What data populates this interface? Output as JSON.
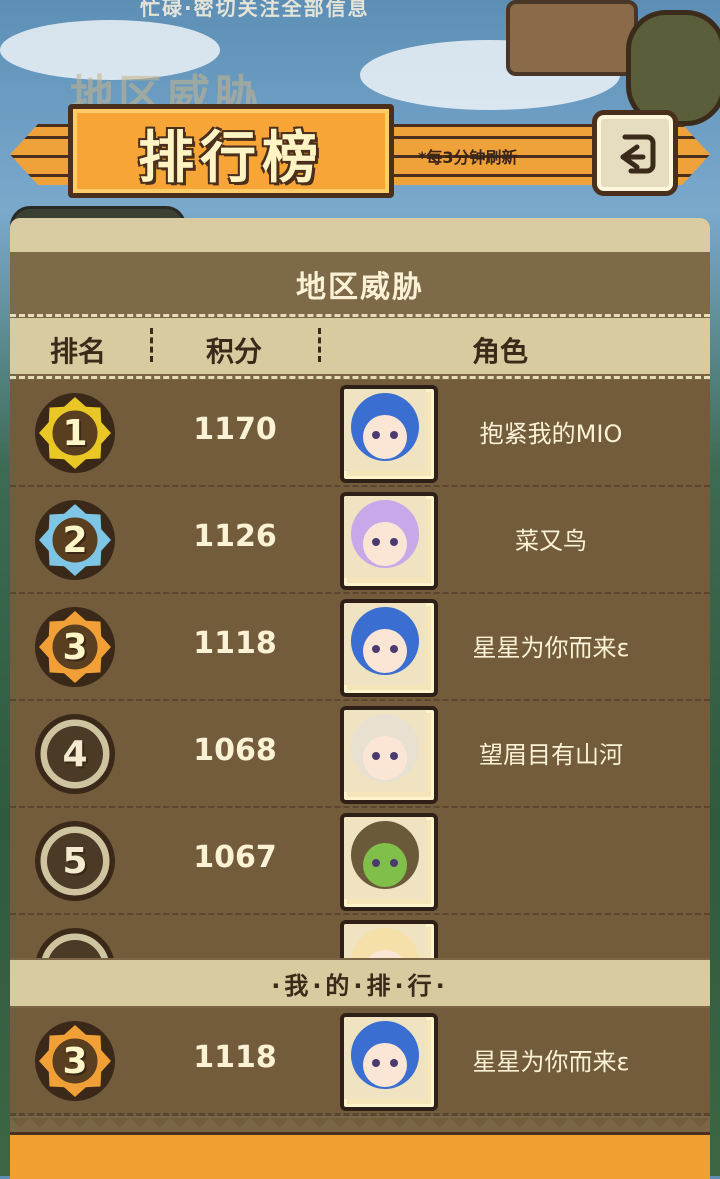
{
  "background": {
    "top_text": "忙碌·密切关注全部信息",
    "sign_text": "地区威胁"
  },
  "banner": {
    "title": "排行榜",
    "refresh_note": "*每3分钟刷新",
    "back_icon": "back-arrow-icon"
  },
  "panel": {
    "title": "地区威胁",
    "headers": {
      "rank": "排名",
      "score": "积分",
      "role": "角色"
    }
  },
  "colors": {
    "gold": "#e9c826",
    "silver": "#7fc6e6",
    "bronze": "#f0a036",
    "plain": "#cfc4a0"
  },
  "rows": [
    {
      "rank": "1",
      "score": "1170",
      "name": "抱紧我的MIO",
      "medal": "gold-medal-icon",
      "avatar": "blue-hair-avatar"
    },
    {
      "rank": "2",
      "score": "1126",
      "name": "菜又鸟",
      "medal": "silver-medal-icon",
      "avatar": "rainbow-hair-avatar"
    },
    {
      "rank": "3",
      "score": "1118",
      "name": "星星为你而来ε",
      "medal": "bronze-medal-icon",
      "avatar": "blue-hair-elf-avatar"
    },
    {
      "rank": "4",
      "score": "1068",
      "name": "望眉目有山河",
      "medal": "plain-medal-icon",
      "avatar": "white-hair-horned-avatar"
    },
    {
      "rank": "5",
      "score": "1067",
      "name": "",
      "medal": "plain-medal-icon",
      "avatar": "green-goblin-avatar"
    },
    {
      "rank": "",
      "score": "",
      "name": "",
      "medal": "plain-medal-icon",
      "avatar": "blonde-avatar"
    }
  ],
  "my_rank": {
    "label": "·我·的·排·行·",
    "rank": "3",
    "score": "1118",
    "name": "星星为你而来ε",
    "medal": "bronze-medal-icon",
    "avatar": "blue-hair-elf-avatar"
  }
}
